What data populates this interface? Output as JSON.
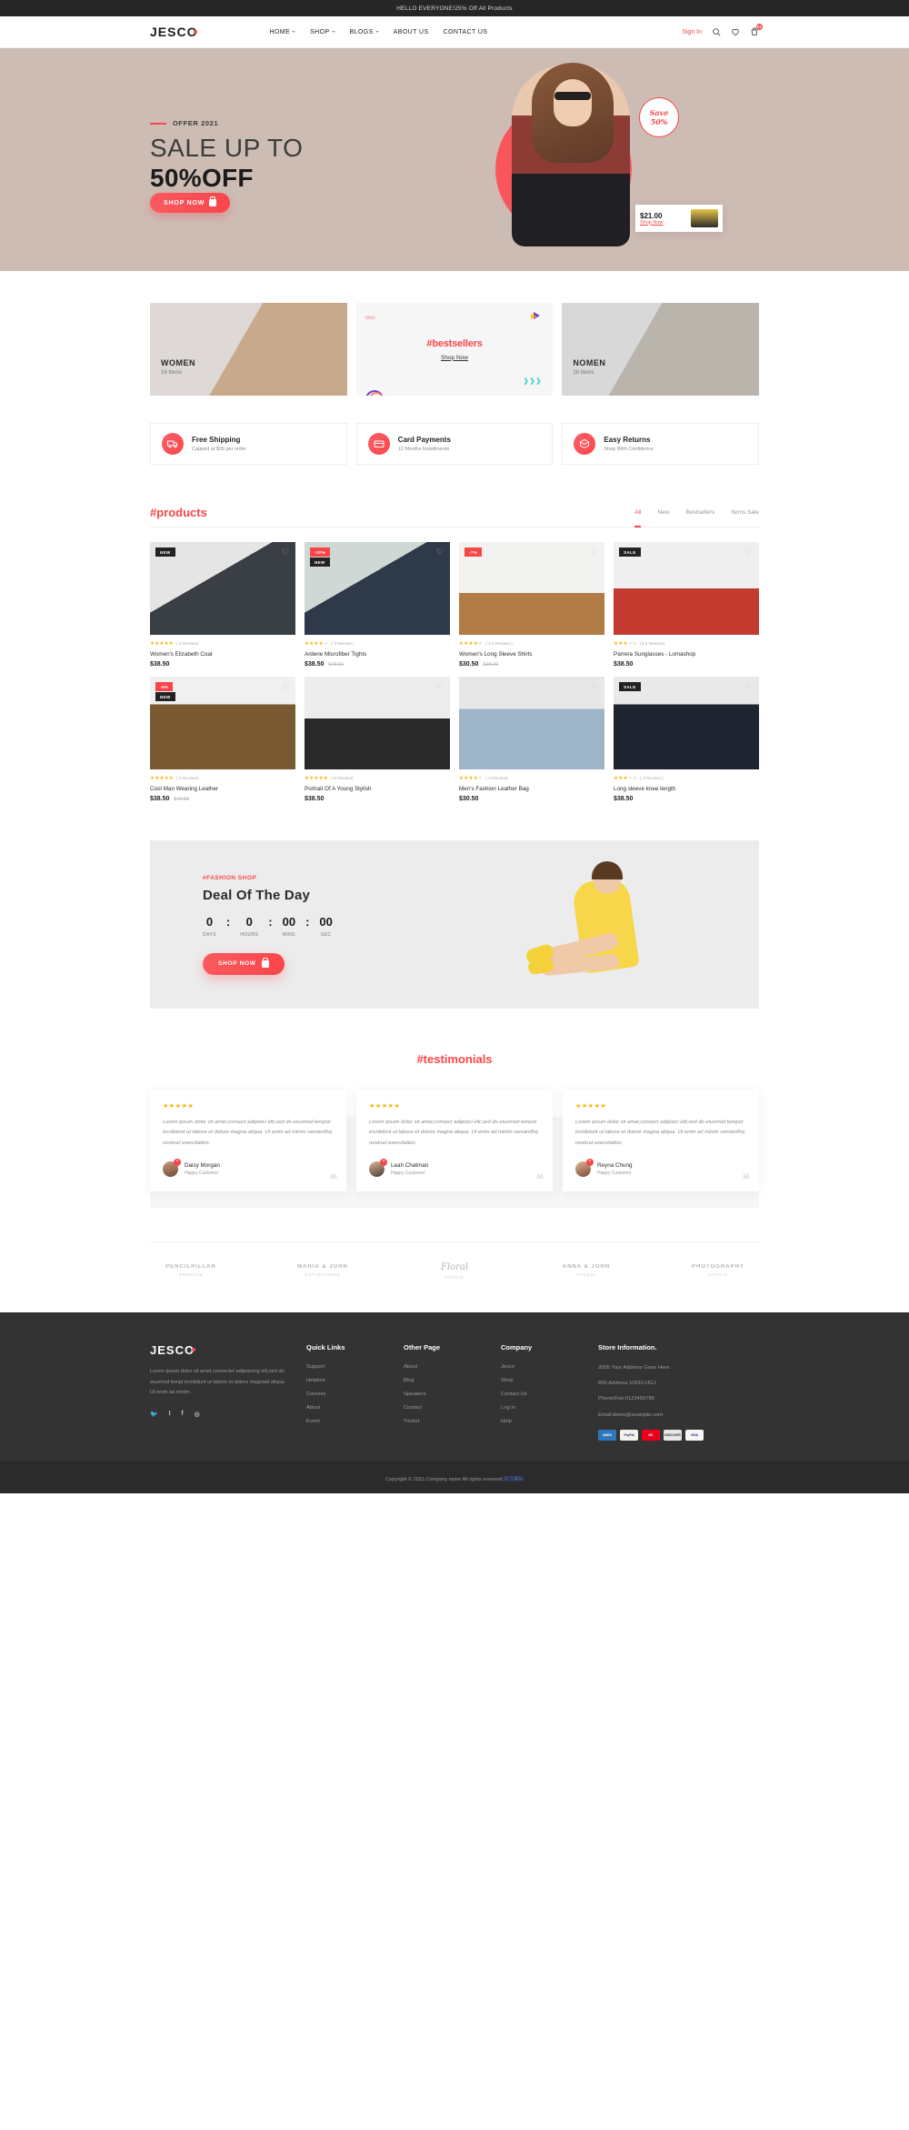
{
  "announcement": {
    "text": "HELLO EVERYONE!25% Off All Products"
  },
  "header": {
    "logo": "JESCO",
    "nav": [
      {
        "label": "HOME",
        "caret": true
      },
      {
        "label": "SHOP",
        "caret": true
      },
      {
        "label": "BLOGS",
        "caret": true
      },
      {
        "label": "ABOUT US",
        "caret": false
      },
      {
        "label": "CONTACT US",
        "caret": false
      }
    ],
    "signin": "Sign In",
    "icons": [
      "search-icon",
      "heart-icon",
      "cart-icon"
    ],
    "cart_count": "01"
  },
  "hero": {
    "offer_label": "OFFER 2021",
    "line1": "SALE UP TO",
    "line2": "50%OFF",
    "button": "SHOP NOW",
    "save_line1": "Save",
    "save_line2": "50%",
    "price": "$21.00",
    "price_link": "Shop Now"
  },
  "categories": [
    {
      "name": "WOMEN",
      "items": "16 Items",
      "type": "image"
    },
    {
      "title": "#bestsellers",
      "link": "Shop Now",
      "type": "promo"
    },
    {
      "name": "NOMEN",
      "items": "16 Items",
      "type": "image"
    }
  ],
  "services": [
    {
      "icon": "truck-icon",
      "title": "Free Shipping",
      "subtitle": "Capped at $39 per order"
    },
    {
      "icon": "card-icon",
      "title": "Card Payments",
      "subtitle": "12 Months Installments"
    },
    {
      "icon": "return-box-icon",
      "title": "Easy Returns",
      "subtitle": "Shop With Confidence"
    }
  ],
  "products": {
    "title": "#products",
    "tabs": [
      {
        "label": "All",
        "active": true
      },
      {
        "label": "New",
        "active": false
      },
      {
        "label": "Bestsellers",
        "active": false
      },
      {
        "label": "Items Sale",
        "active": false
      }
    ],
    "items": [
      {
        "name": "Women's Elizabeth Coat",
        "price": "$38.50",
        "old_price": "",
        "stars": 5,
        "reviews": "( 5 Review)",
        "tags": [
          {
            "text": "NEW",
            "style": "dark"
          }
        ]
      },
      {
        "name": "Ardene Microfiber Tights",
        "price": "$38.50",
        "old_price": "$48.50",
        "stars": 4,
        "reviews": "( 4 Review )",
        "tags": [
          {
            "text": "-10%",
            "style": "red"
          },
          {
            "text": "NEW",
            "style": "dark"
          }
        ]
      },
      {
        "name": "Women's Long Sleeve Shirts",
        "price": "$30.50",
        "old_price": "$38.00",
        "stars": 4.5,
        "reviews": "( 4.5 Review )",
        "tags": [
          {
            "text": "-7%",
            "style": "red"
          }
        ]
      },
      {
        "name": "Parrera Sunglasses - Lomashop",
        "price": "$38.50",
        "old_price": "",
        "stars": 3.5,
        "reviews": "(3.5 Review)",
        "tags": [
          {
            "text": "SALE",
            "style": "dark"
          }
        ]
      },
      {
        "name": "Cool Man Wearing Leather",
        "price": "$38.50",
        "old_price": "$40.50",
        "stars": 5,
        "reviews": "( 5 Review)",
        "tags": [
          {
            "text": "-5%",
            "style": "red"
          },
          {
            "text": "NEW",
            "style": "dark"
          }
        ]
      },
      {
        "name": "Portrait Of A Young Stylish",
        "price": "$38.50",
        "old_price": "",
        "stars": 5,
        "reviews": "( 5 Review)",
        "tags": []
      },
      {
        "name": "Men's Fashion Leather Bag",
        "price": "$30.50",
        "old_price": "",
        "stars": 4,
        "reviews": "( 4 Review)",
        "tags": []
      },
      {
        "name": "Long sleeve knee length",
        "price": "$38.50",
        "old_price": "",
        "stars": 3,
        "reviews": "( 3 Review )",
        "tags": [
          {
            "text": "SALE",
            "style": "dark"
          }
        ]
      }
    ]
  },
  "deal": {
    "kicker": "#FASHION SHOP",
    "title": "Deal Of The Day",
    "counters": [
      {
        "value": "0",
        "label": "DAYS"
      },
      {
        "value": "0",
        "label": "HOURS"
      },
      {
        "value": "00",
        "label": "MINS"
      },
      {
        "value": "00",
        "label": "SEC"
      }
    ],
    "button": "SHOP NOW"
  },
  "testimonials": {
    "title": "#testimonials",
    "items": [
      {
        "stars": 5,
        "text": "Lorem ipsum dolor sit amet,consect adipisici elit,sed do eiusmod tempol incididunt ut labore et dolore magna aliqua. Ut enim ad minim veniamfhq nostrud exercitation.",
        "name": "Daisy Morgan",
        "role": "Happy Customer"
      },
      {
        "stars": 5,
        "text": "Lorem ipsum dolor sit amet,consect adipisici elit,sed do eiusmod tempol incididunt ut labore et dolore magna aliqua. Ut enim ad minim veniamfhq nostrud exercitation.",
        "name": "Leah Chatman",
        "role": "Happy Customer"
      },
      {
        "stars": 5,
        "text": "Lorem ipsum dolor sit amet,consect adipisici elit,sed do eiusmod tempol incididunt ut labore et dolore magna aliqua. Ut enim ad minim veniamfhq nostrud exercitation.",
        "name": "Reyna Chung",
        "role": "Happy Customer"
      }
    ]
  },
  "brands": [
    {
      "name": "PENCILPILLAR",
      "sub": "PREMIUM"
    },
    {
      "name": "MARIA & JOHN",
      "sub": "ESTABLISHED"
    },
    {
      "name": "Floral",
      "sub": "STUDIO",
      "script": true
    },
    {
      "name": "ANNA & JOHN",
      "sub": "STUDIO"
    },
    {
      "name": "PHOTOGRAPHY",
      "sub": "STUDIO"
    }
  ],
  "footer": {
    "logo": "JESCO",
    "description": "Lorem ipsum dolor sit amet consectet adipisicing elit,sed do eiusmod templ incididunt ut labore et dolore magnaol aliqua Ut enim ad minim.",
    "social": [
      "twitter-icon",
      "tumblr-icon",
      "facebook-icon",
      "instagram-icon"
    ],
    "columns": [
      {
        "heading": "Quick Links",
        "links": [
          "Support",
          "Helpline",
          "Courses",
          "About",
          "Event"
        ]
      },
      {
        "heading": "Other Page",
        "links": [
          "About",
          "Blog",
          "Speakers",
          "Contact",
          "Tricket"
        ]
      },
      {
        "heading": "Company",
        "links": [
          "Jesco",
          "Shop",
          "Contact Us",
          "Log In",
          "Help"
        ]
      }
    ],
    "store": {
      "heading": "Store Information.",
      "lines": [
        "2005 Your Address Goes Here.",
        "896,Address 10010,HGJ",
        "Phone/Fax:0123456789",
        "Email:demo@example.com"
      ],
      "payments": [
        "AMEX",
        "PayPal",
        "MC",
        "DISCOVER",
        "VISA"
      ]
    },
    "copyright": "Copyright © 2021.Company name All rights reserved.",
    "copyright_link": "网页模板"
  }
}
